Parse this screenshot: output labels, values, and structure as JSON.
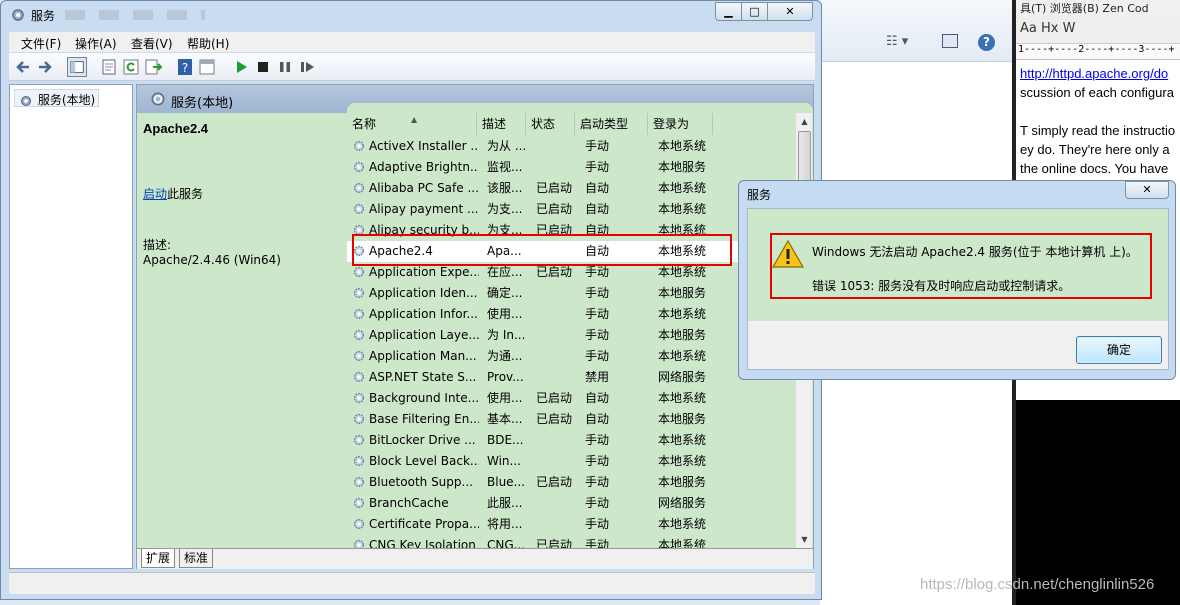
{
  "window": {
    "title": "服务",
    "menu": [
      "文件(F)",
      "操作(A)",
      "查看(V)",
      "帮助(H)"
    ]
  },
  "tree": {
    "root_label": "服务(本地)"
  },
  "pane": {
    "header_title": "服务(本地)"
  },
  "selected_service": {
    "name": "Apache2.4",
    "start_link": "启动",
    "start_suffix": "此服务",
    "desc_label": "描述:",
    "desc_value": "Apache/2.4.46 (Win64)"
  },
  "columns": [
    "名称",
    "描述",
    "状态",
    "启动类型",
    "登录为"
  ],
  "rows": [
    {
      "name": "ActiveX Installer ...",
      "desc": "为从 ...",
      "status": "",
      "startup": "手动",
      "logon": "本地系统"
    },
    {
      "name": "Adaptive Brightn...",
      "desc": "监视...",
      "status": "",
      "startup": "手动",
      "logon": "本地服务"
    },
    {
      "name": "Alibaba PC Safe ...",
      "desc": "该服...",
      "status": "已启动",
      "startup": "自动",
      "logon": "本地系统"
    },
    {
      "name": "Alipay payment ...",
      "desc": "为支...",
      "status": "已启动",
      "startup": "自动",
      "logon": "本地系统"
    },
    {
      "name": "Alipay security b...",
      "desc": "为支...",
      "status": "已启动",
      "startup": "自动",
      "logon": "本地系统"
    },
    {
      "name": "Apache2.4",
      "desc": "Apa...",
      "status": "",
      "startup": "自动",
      "logon": "本地系统"
    },
    {
      "name": "Application Expe...",
      "desc": "在应...",
      "status": "已启动",
      "startup": "手动",
      "logon": "本地系统"
    },
    {
      "name": "Application Iden...",
      "desc": "确定...",
      "status": "",
      "startup": "手动",
      "logon": "本地服务"
    },
    {
      "name": "Application Infor...",
      "desc": "使用...",
      "status": "",
      "startup": "手动",
      "logon": "本地系统"
    },
    {
      "name": "Application Laye...",
      "desc": "为 In...",
      "status": "",
      "startup": "手动",
      "logon": "本地服务"
    },
    {
      "name": "Application Man...",
      "desc": "为通...",
      "status": "",
      "startup": "手动",
      "logon": "本地系统"
    },
    {
      "name": "ASP.NET State S...",
      "desc": "Prov...",
      "status": "",
      "startup": "禁用",
      "logon": "网络服务"
    },
    {
      "name": "Background Inte...",
      "desc": "使用...",
      "status": "已启动",
      "startup": "自动",
      "logon": "本地系统"
    },
    {
      "name": "Base Filtering En...",
      "desc": "基本...",
      "status": "已启动",
      "startup": "自动",
      "logon": "本地服务"
    },
    {
      "name": "BitLocker Drive ...",
      "desc": "BDE...",
      "status": "",
      "startup": "手动",
      "logon": "本地系统"
    },
    {
      "name": "Block Level Back...",
      "desc": "Win...",
      "status": "",
      "startup": "手动",
      "logon": "本地系统"
    },
    {
      "name": "Bluetooth Supp...",
      "desc": "Blue...",
      "status": "已启动",
      "startup": "手动",
      "logon": "本地服务"
    },
    {
      "name": "BranchCache",
      "desc": "此服...",
      "status": "",
      "startup": "手动",
      "logon": "网络服务"
    },
    {
      "name": "Certificate Propa...",
      "desc": "将用...",
      "status": "",
      "startup": "手动",
      "logon": "本地系统"
    },
    {
      "name": "CNG Key Isolation",
      "desc": "CNG...",
      "status": "已启动",
      "startup": "手动",
      "logon": "本地系统"
    }
  ],
  "tabs": [
    "扩展",
    "标准"
  ],
  "dialog": {
    "title": "服务",
    "line1": "Windows 无法启动 Apache2.4 服务(位于 本地计算机 上)。",
    "line2": "错误 1053: 服务没有及时响应启动或控制请求。",
    "ok_label": "确定",
    "close_glyph": "✕"
  },
  "background_editor": {
    "menu_text": "具(T)   浏览器(B)   Zen Cod",
    "toolbar_text": "Aa Hx W",
    "ruler_text": "1----+----2----+----3----+",
    "link_line": "http://httpd.apache.org/do",
    "lines": [
      "scussion of each configura",
      "",
      "T simply read the instructio",
      "ey do.  They're here only a",
      "the online docs. You have"
    ]
  },
  "watermark": "https://blog.csdn.net/chenglinlin526",
  "colors": {
    "highlight_red": "#e60000",
    "list_green": "#cde7cb",
    "header_blue": "#9fb6d1"
  }
}
